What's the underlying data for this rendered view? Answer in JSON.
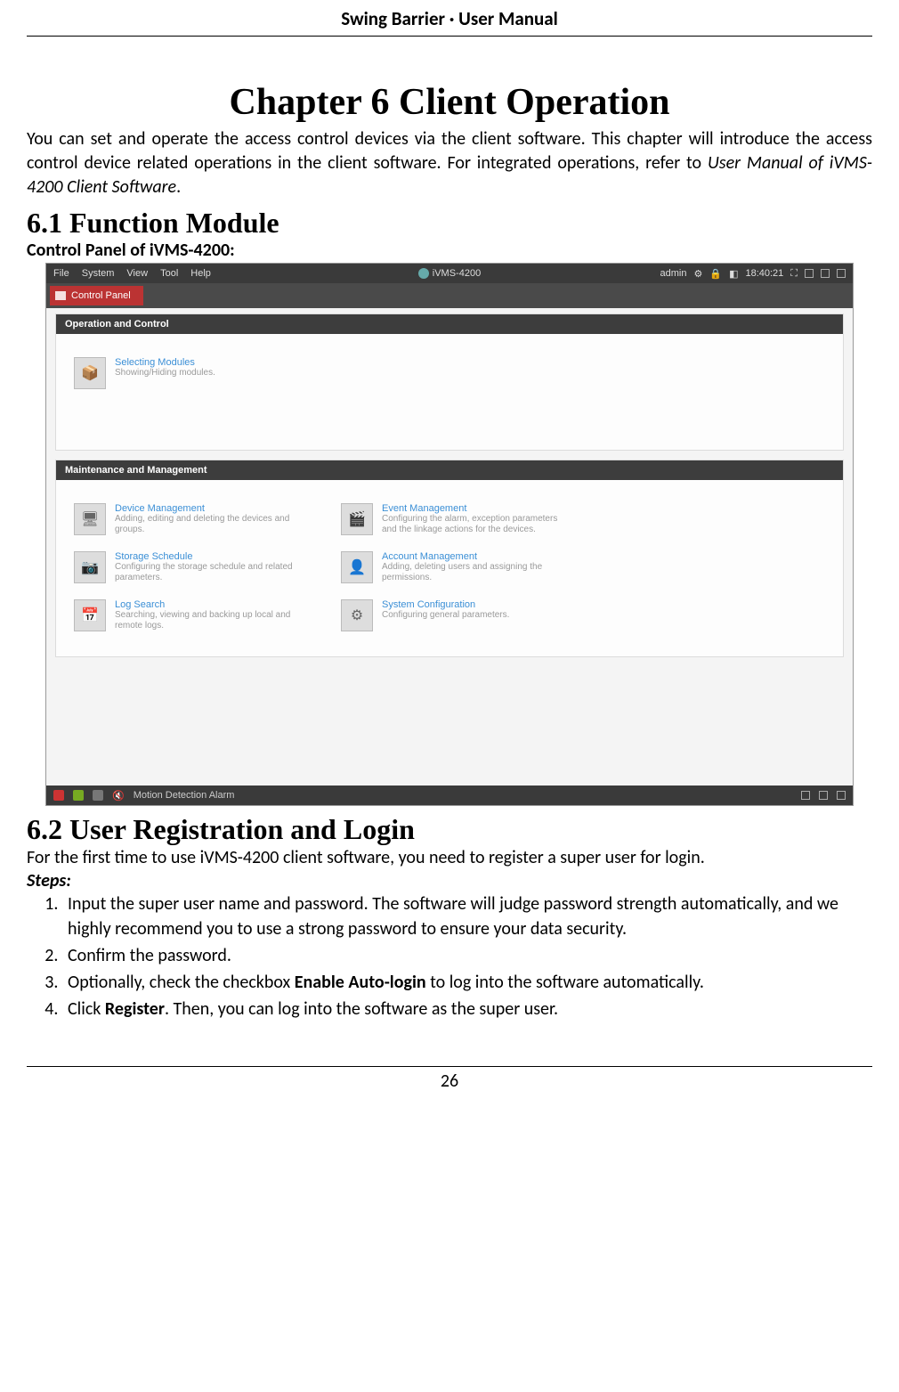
{
  "doc_header": "Swing Barrier · User Manual",
  "page_number": "26",
  "chapter": {
    "title": "Chapter 6 Client Operation",
    "intro_plain": "You can set and operate the access control devices via the client software. This chapter will introduce the access control device related operations in the client software. For integrated operations, refer to ",
    "intro_ital": "User Manual of iVMS-4200 Client Software",
    "intro_tail": "."
  },
  "section61": {
    "title": "6.1  Function Module",
    "subhead": "Control Panel of iVMS-4200:"
  },
  "screenshot": {
    "menu": {
      "file": "File",
      "system": "System",
      "view": "View",
      "tool": "Tool",
      "help": "Help"
    },
    "app_name": "iVMS-4200",
    "user": "admin",
    "clock": "18:40:21",
    "tab_label": "Control Panel",
    "panel_op": "Operation and Control",
    "panel_mm": "Maintenance and Management",
    "tiles_op": [
      {
        "name": "Selecting Modules",
        "desc": "Showing/Hiding modules."
      }
    ],
    "tiles_mm": [
      {
        "name": "Device Management",
        "desc": "Adding, editing and deleting the devices and groups."
      },
      {
        "name": "Event Management",
        "desc": "Configuring the alarm, exception parameters and the linkage actions for the devices."
      },
      {
        "name": "Storage Schedule",
        "desc": "Configuring the storage schedule and related parameters."
      },
      {
        "name": "Account Management",
        "desc": "Adding, deleting users and assigning the permissions."
      },
      {
        "name": "Log Search",
        "desc": "Searching, viewing and backing up local and remote logs."
      },
      {
        "name": "System Configuration",
        "desc": "Configuring general parameters."
      }
    ],
    "status_text": "Motion Detection Alarm"
  },
  "section62": {
    "title": "6.2  User Registration and Login",
    "lead": "For the first time to use iVMS-4200 client software, you need to register a super user for login.",
    "steps_label": "Steps:",
    "steps": {
      "s1": "Input the super user name and password. The software will judge password strength automatically, and we highly recommend you to use a strong password to ensure your data security.",
      "s2": "Confirm the password.",
      "s3a": "Optionally, check the checkbox ",
      "s3b": "Enable Auto-login",
      "s3c": " to log into the software automatically.",
      "s4a": "Click ",
      "s4b": "Register",
      "s4c": ". Then, you can log into the software as the super user."
    }
  }
}
